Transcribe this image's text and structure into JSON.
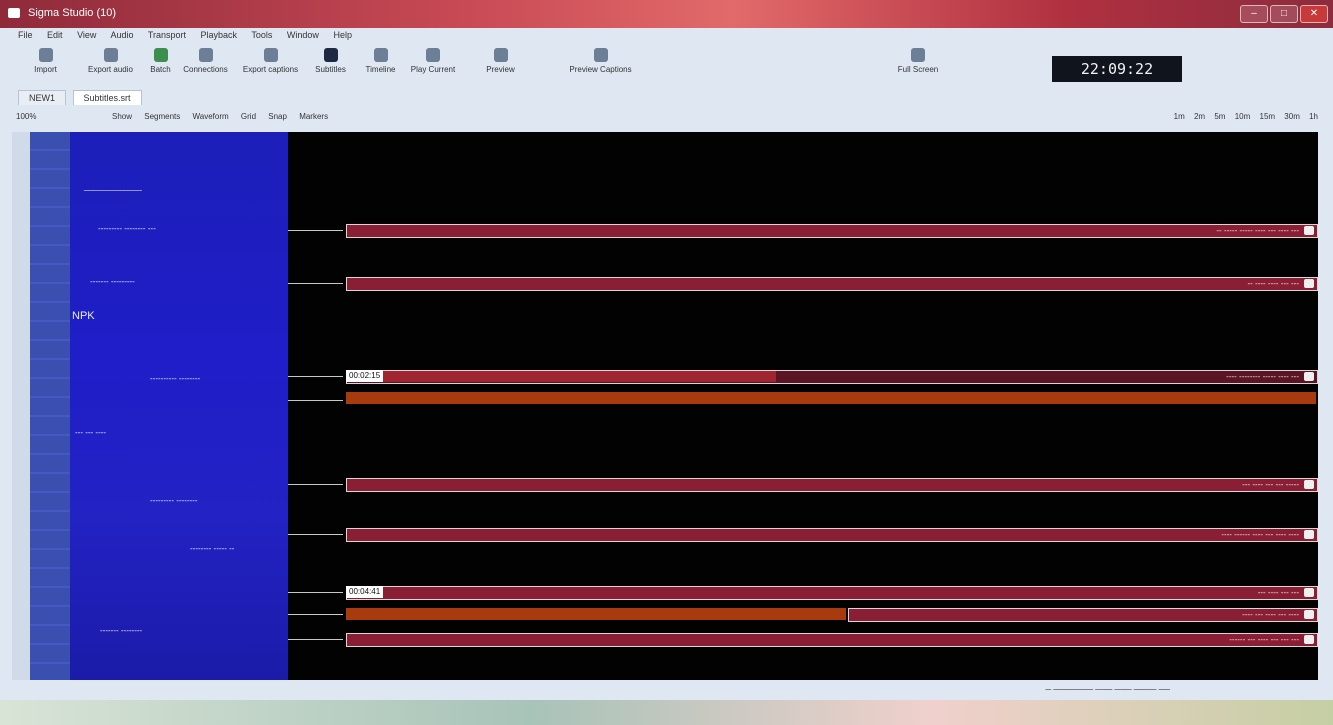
{
  "window": {
    "title": "Sigma Studio (10)",
    "min_label": "–",
    "max_label": "□",
    "close_label": "✕"
  },
  "menu": [
    "File",
    "Edit",
    "View",
    "Audio",
    "Transport",
    "Playback",
    "Tools",
    "Window",
    "Help"
  ],
  "toolbar": {
    "items": [
      {
        "label": "Import",
        "icon": "import-icon"
      },
      {
        "label": "Export audio",
        "icon": "export-icon"
      },
      {
        "label": "Batch",
        "icon": "batch-icon"
      },
      {
        "label": "Connections",
        "icon": "connections-icon"
      },
      {
        "label": "Export captions",
        "icon": "captions-icon"
      },
      {
        "label": "Subtitles",
        "icon": "subtitles-icon"
      },
      {
        "label": "Timeline",
        "icon": "timeline-icon"
      },
      {
        "label": "Play Current",
        "icon": "play-icon"
      },
      {
        "label": "Preview",
        "icon": "preview-icon"
      },
      {
        "label": "Preview Captions",
        "icon": "preview-captions-icon"
      },
      {
        "label": "Full Screen",
        "icon": "fullscreen-icon"
      }
    ]
  },
  "clock": "22:09:22",
  "tabs": [
    "NEW1",
    "Subtitles.srt"
  ],
  "subtoolbar": {
    "zoom": "100%",
    "left_items": [
      "Show",
      "Segments",
      "Waveform",
      "Grid",
      "Snap",
      "Markers"
    ],
    "right_items": [
      "1m",
      "2m",
      "5m",
      "10m",
      "15m",
      "30m",
      "1h"
    ]
  },
  "unit_labels": [
    "_____________",
    "--------- -------- ---",
    "------- ---------",
    "NPK",
    "---------- --------",
    "--- --- ----",
    "--------- --------",
    "-------- ----- --",
    "------- --------"
  ],
  "segments": [
    {
      "text": "-- ----- ----- ---- --- ---- ---"
    },
    {
      "text": "-- ---- ---- --- ---"
    },
    {
      "text": "---- -------- ----- ---- ---",
      "label": "00:02:15"
    },
    {
      "text": "--- ---- --- --- -----"
    },
    {
      "text": "---- ------ ---- --- ---- ----"
    },
    {
      "text": "--- ---- --- ---",
      "label": "00:04:41"
    },
    {
      "text": "---- --- ---- --- ----"
    },
    {
      "text": "------ --- ---- --- --- ---"
    }
  ],
  "status": {
    "text": "─ ─────── ─── ─── ──── ──"
  }
}
